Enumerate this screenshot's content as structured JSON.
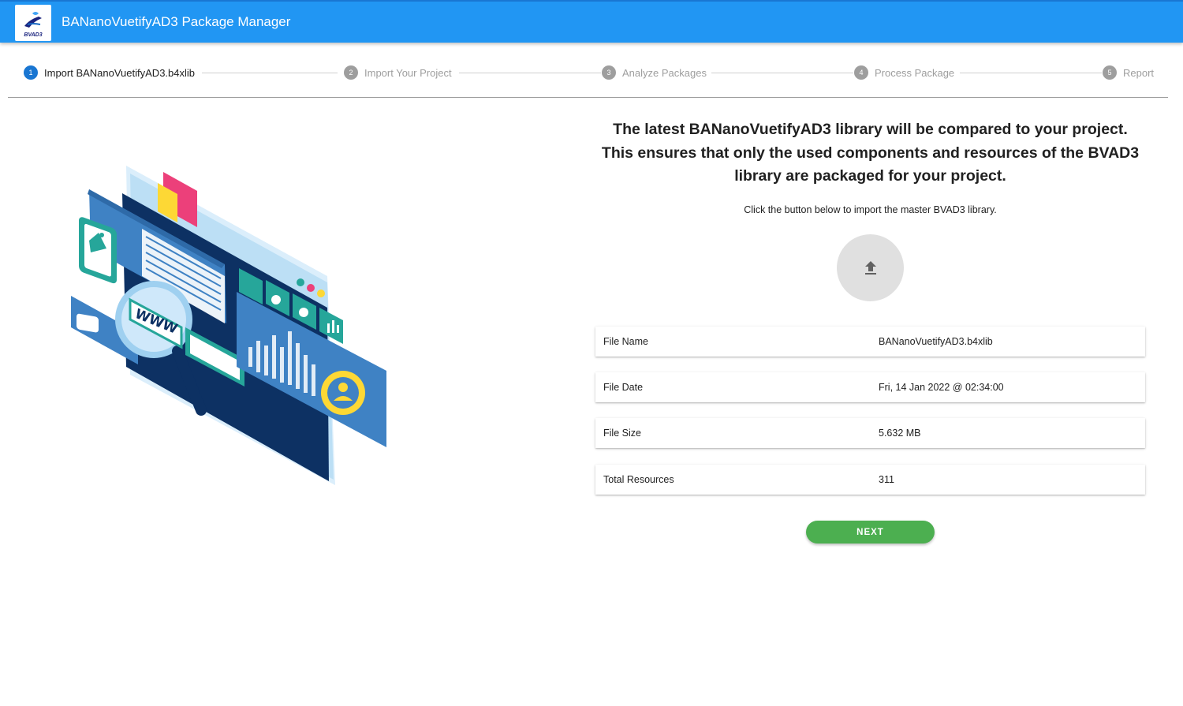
{
  "app": {
    "title": "BANanoVuetifyAD3 Package Manager",
    "logo_text": "BVAD3"
  },
  "stepper": {
    "steps": [
      {
        "number": "1",
        "label": "Import BANanoVuetifyAD3.b4xlib",
        "active": true
      },
      {
        "number": "2",
        "label": "Import Your Project",
        "active": false
      },
      {
        "number": "3",
        "label": "Analyze Packages",
        "active": false
      },
      {
        "number": "4",
        "label": "Process Package",
        "active": false
      },
      {
        "number": "5",
        "label": "Report",
        "active": false
      }
    ]
  },
  "main": {
    "headline": "The latest BANanoVuetifyAD3 library will be compared to your project. This ensures that only the used components and resources of the BVAD3 library are packaged for your project.",
    "instruction": "Click the button below to import the master BVAD3 library.",
    "upload_icon": "upload-icon",
    "file_info": [
      {
        "label": "File Name",
        "value": "BANanoVuetifyAD3.b4xlib"
      },
      {
        "label": "File Date",
        "value": "Fri, 14 Jan 2022 @ 02:34:00"
      },
      {
        "label": "File Size",
        "value": "5.632 MB"
      },
      {
        "label": "Total Resources",
        "value": "311"
      }
    ],
    "next_label": "NEXT"
  },
  "illustration": {
    "www_text": "WWW"
  },
  "colors": {
    "appbar": "#2196f3",
    "active_step": "#1976d2",
    "next_button": "#4caf50"
  }
}
